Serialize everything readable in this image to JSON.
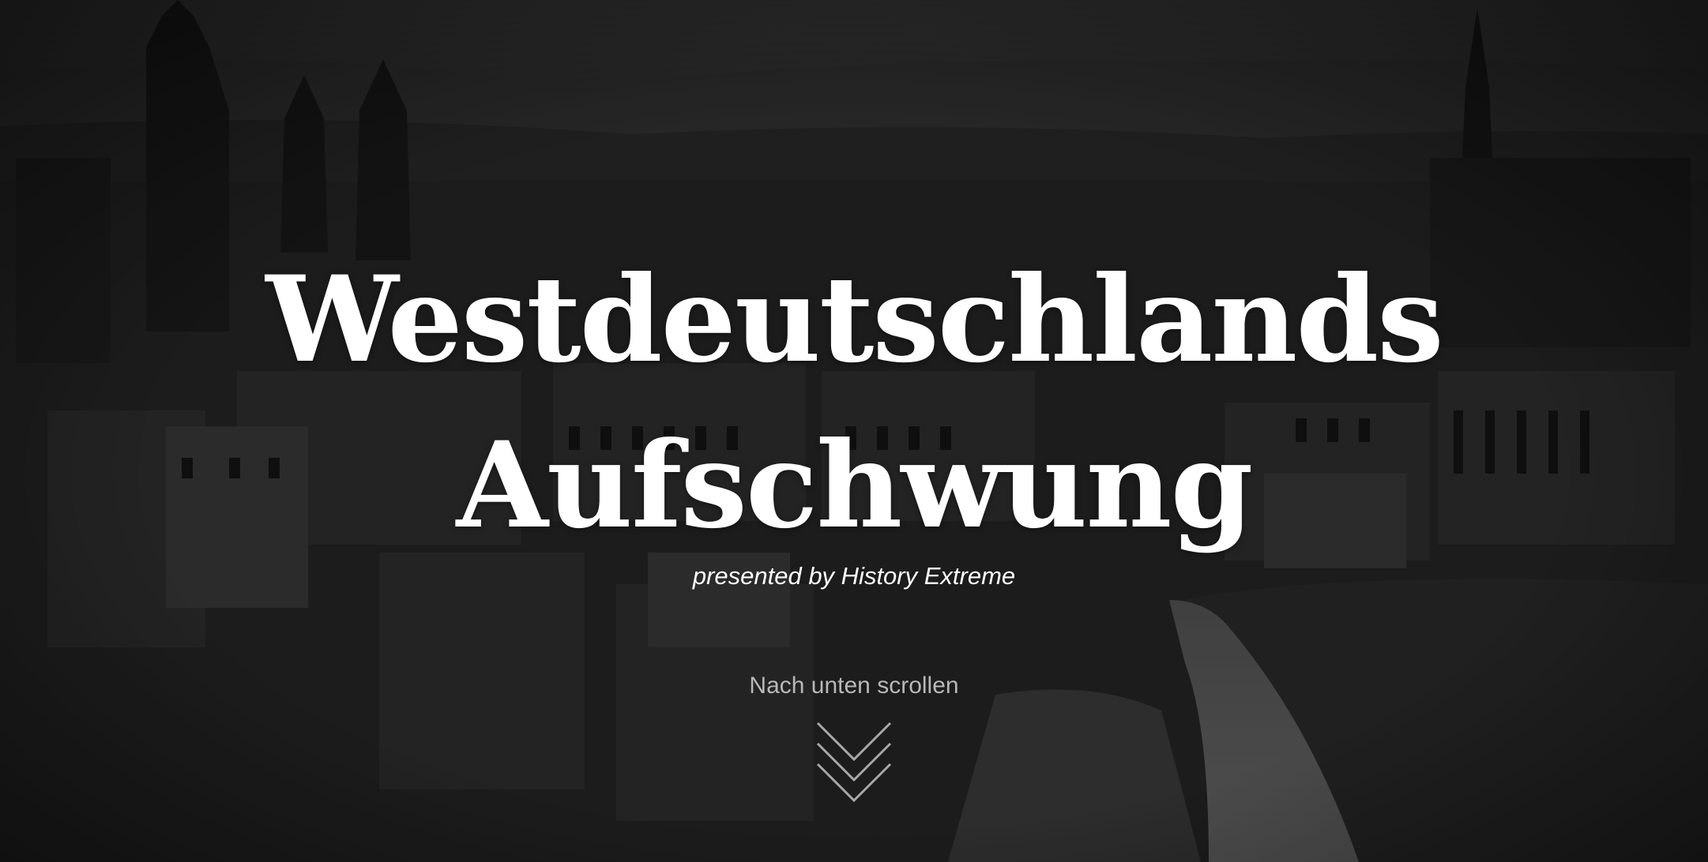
{
  "hero": {
    "title_line1": "Westdeutschlands",
    "title_line2": "Aufschwung",
    "subtitle": "presented by History Extreme",
    "scroll_hint": "Nach unten scrollen",
    "scroll_icon": "double-chevron-down-icon",
    "background_image": "black-and-white photo of a bombed-out city in ruins",
    "text_color": "#ffffff",
    "hint_color": "#b8b8b8"
  }
}
